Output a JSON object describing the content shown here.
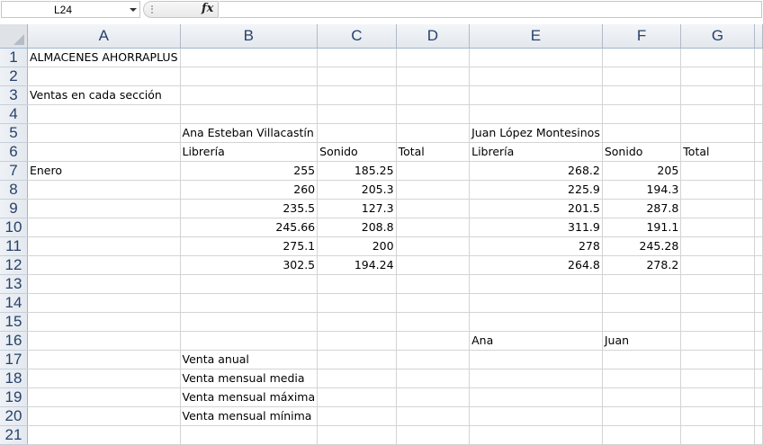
{
  "formula_bar": {
    "name_box": "L24",
    "fx_label": "fx",
    "formula": ""
  },
  "columns": [
    "A",
    "B",
    "C",
    "D",
    "E",
    "F",
    "G"
  ],
  "rows": [
    [
      "ALMACENES AHORRAPLUS",
      "",
      "",
      "",
      "",
      "",
      ""
    ],
    [
      "",
      "",
      "",
      "",
      "",
      "",
      ""
    ],
    [
      "Ventas en cada sección",
      "",
      "",
      "",
      "",
      "",
      ""
    ],
    [
      "",
      "",
      "",
      "",
      "",
      "",
      ""
    ],
    [
      "",
      "Ana Esteban Villacastín",
      "",
      "",
      "Juan López Montesinos",
      "",
      ""
    ],
    [
      "",
      "Librería",
      "Sonido",
      "Total",
      "Librería",
      "Sonido",
      "Total"
    ],
    [
      "Enero",
      "255",
      "185.25",
      "",
      "268.2",
      "205",
      ""
    ],
    [
      "",
      "260",
      "205.3",
      "",
      "225.9",
      "194.3",
      ""
    ],
    [
      "",
      "235.5",
      "127.3",
      "",
      "201.5",
      "287.8",
      ""
    ],
    [
      "",
      "245.66",
      "208.8",
      "",
      "311.9",
      "191.1",
      ""
    ],
    [
      "",
      "275.1",
      "200",
      "",
      "278",
      "245.28",
      ""
    ],
    [
      "",
      "302.5",
      "194.24",
      "",
      "264.8",
      "278.2",
      ""
    ],
    [
      "",
      "",
      "",
      "",
      "",
      "",
      ""
    ],
    [
      "",
      "",
      "",
      "",
      "",
      "",
      ""
    ],
    [
      "",
      "",
      "",
      "",
      "",
      "",
      ""
    ],
    [
      "",
      "",
      "",
      "",
      "Ana",
      "Juan",
      ""
    ],
    [
      "",
      "Venta anual",
      "",
      "",
      "",
      "",
      ""
    ],
    [
      "",
      "Venta mensual media",
      "",
      "",
      "",
      "",
      ""
    ],
    [
      "",
      "Venta mensual máxima",
      "",
      "",
      "",
      "",
      ""
    ],
    [
      "",
      "Venta mensual mínima",
      "",
      "",
      "",
      "",
      ""
    ],
    [
      "",
      "",
      "",
      "",
      "",
      "",
      ""
    ]
  ],
  "row_numbers": [
    "1",
    "2",
    "3",
    "4",
    "5",
    "6",
    "7",
    "8",
    "9",
    "10",
    "11",
    "12",
    "13",
    "14",
    "15",
    "16",
    "17",
    "18",
    "19",
    "20",
    "21"
  ],
  "colors": {
    "header_text": "#27416b",
    "grid_line": "#d4d4d4",
    "header_border": "#9eb6ce"
  }
}
